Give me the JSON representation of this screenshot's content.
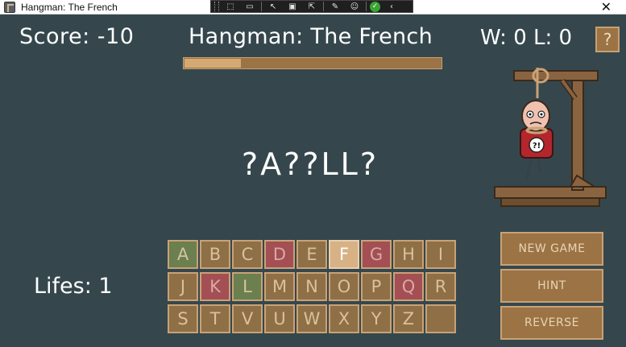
{
  "window": {
    "title": "Hangman: The French",
    "close": "✕"
  },
  "toolbar": {
    "buttons": [
      {
        "icon": "select-element-icon",
        "glyph": "⬚"
      },
      {
        "icon": "video-icon",
        "glyph": "▭"
      },
      {
        "icon": "pointer-icon",
        "glyph": "↖"
      },
      {
        "icon": "frame-icon",
        "glyph": "▣"
      },
      {
        "icon": "cursor-select-icon",
        "glyph": "⇱"
      },
      {
        "icon": "brush-icon",
        "glyph": "✎"
      },
      {
        "icon": "accessibility-icon",
        "glyph": "☺"
      }
    ],
    "check_icon": "checkmark-icon",
    "check_glyph": "✓",
    "collapse_glyph": "‹"
  },
  "game": {
    "score_label": "Score: -10",
    "title": "Hangman: The French",
    "wins_losses": "W: 0  L: 0",
    "help_label": "?",
    "progress": 0.22,
    "word": "?A??LL?",
    "lifes_label": "Lifes: 1"
  },
  "keyboard": {
    "keys": [
      {
        "letter": "A",
        "state": "correct"
      },
      {
        "letter": "B",
        "state": "default"
      },
      {
        "letter": "C",
        "state": "default"
      },
      {
        "letter": "D",
        "state": "wrong"
      },
      {
        "letter": "E",
        "state": "default"
      },
      {
        "letter": "F",
        "state": "selected"
      },
      {
        "letter": "G",
        "state": "wrong"
      },
      {
        "letter": "H",
        "state": "default"
      },
      {
        "letter": "I",
        "state": "default"
      },
      {
        "letter": "J",
        "state": "default"
      },
      {
        "letter": "K",
        "state": "wrong"
      },
      {
        "letter": "L",
        "state": "correct"
      },
      {
        "letter": "M",
        "state": "default"
      },
      {
        "letter": "N",
        "state": "default"
      },
      {
        "letter": "O",
        "state": "default"
      },
      {
        "letter": "P",
        "state": "default"
      },
      {
        "letter": "Q",
        "state": "wrong"
      },
      {
        "letter": "R",
        "state": "default"
      },
      {
        "letter": "S",
        "state": "default"
      },
      {
        "letter": "T",
        "state": "default"
      },
      {
        "letter": "V",
        "state": "default"
      },
      {
        "letter": "U",
        "state": "default"
      },
      {
        "letter": "W",
        "state": "default"
      },
      {
        "letter": "X",
        "state": "default"
      },
      {
        "letter": "Y",
        "state": "default"
      },
      {
        "letter": "Z",
        "state": "default"
      },
      {
        "letter": "",
        "state": "blank"
      }
    ]
  },
  "actions": {
    "new_game": "NEW GAME",
    "hint": "HINT",
    "reverse": "REVERSE"
  },
  "scene": {
    "shirt_text": "?!",
    "colors": {
      "wood": "#8a6440",
      "shirt": "#b3262c",
      "skin": "#f1c1b0"
    }
  }
}
